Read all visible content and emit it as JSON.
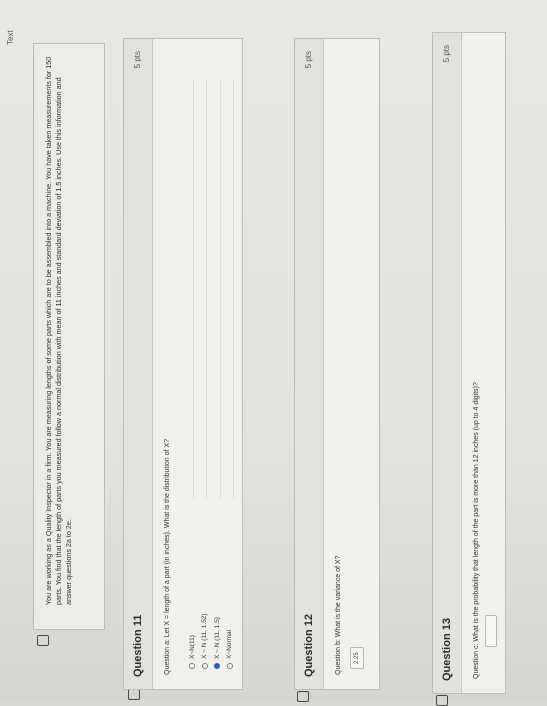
{
  "top_label": "Text",
  "intro": {
    "text": "You are working as a Quality Inspector in a firm. You are measuring lengths of some parts which are to be assembled into a machine. You have taken measurements for 150 parts. You find that the length of parts you measured follow a normal distribution with mean of 11 inches and standard deviation of 1.5 inches. Use this information and answer questions 2a to 2e."
  },
  "q11": {
    "title": "Question 11",
    "points": "5 pts",
    "question": "Question a: Let X = length of a part (in inches). What is the distribution of X?",
    "options": [
      "X~N(11)",
      "X ~ N (11, 1.52)",
      "X ~ N (11, 1.5)",
      "X~Normal"
    ],
    "selected_index": 2
  },
  "q12": {
    "title": "Question 12",
    "points": "5 pts",
    "question": "Question b: What is the variance of X?",
    "answer": "2.25"
  },
  "q13": {
    "title": "Question 13",
    "points": "5 pts",
    "question": "Question c: What is the probability that length of the part is more than 12 inches (up to 4 digits)?",
    "answer": ""
  }
}
